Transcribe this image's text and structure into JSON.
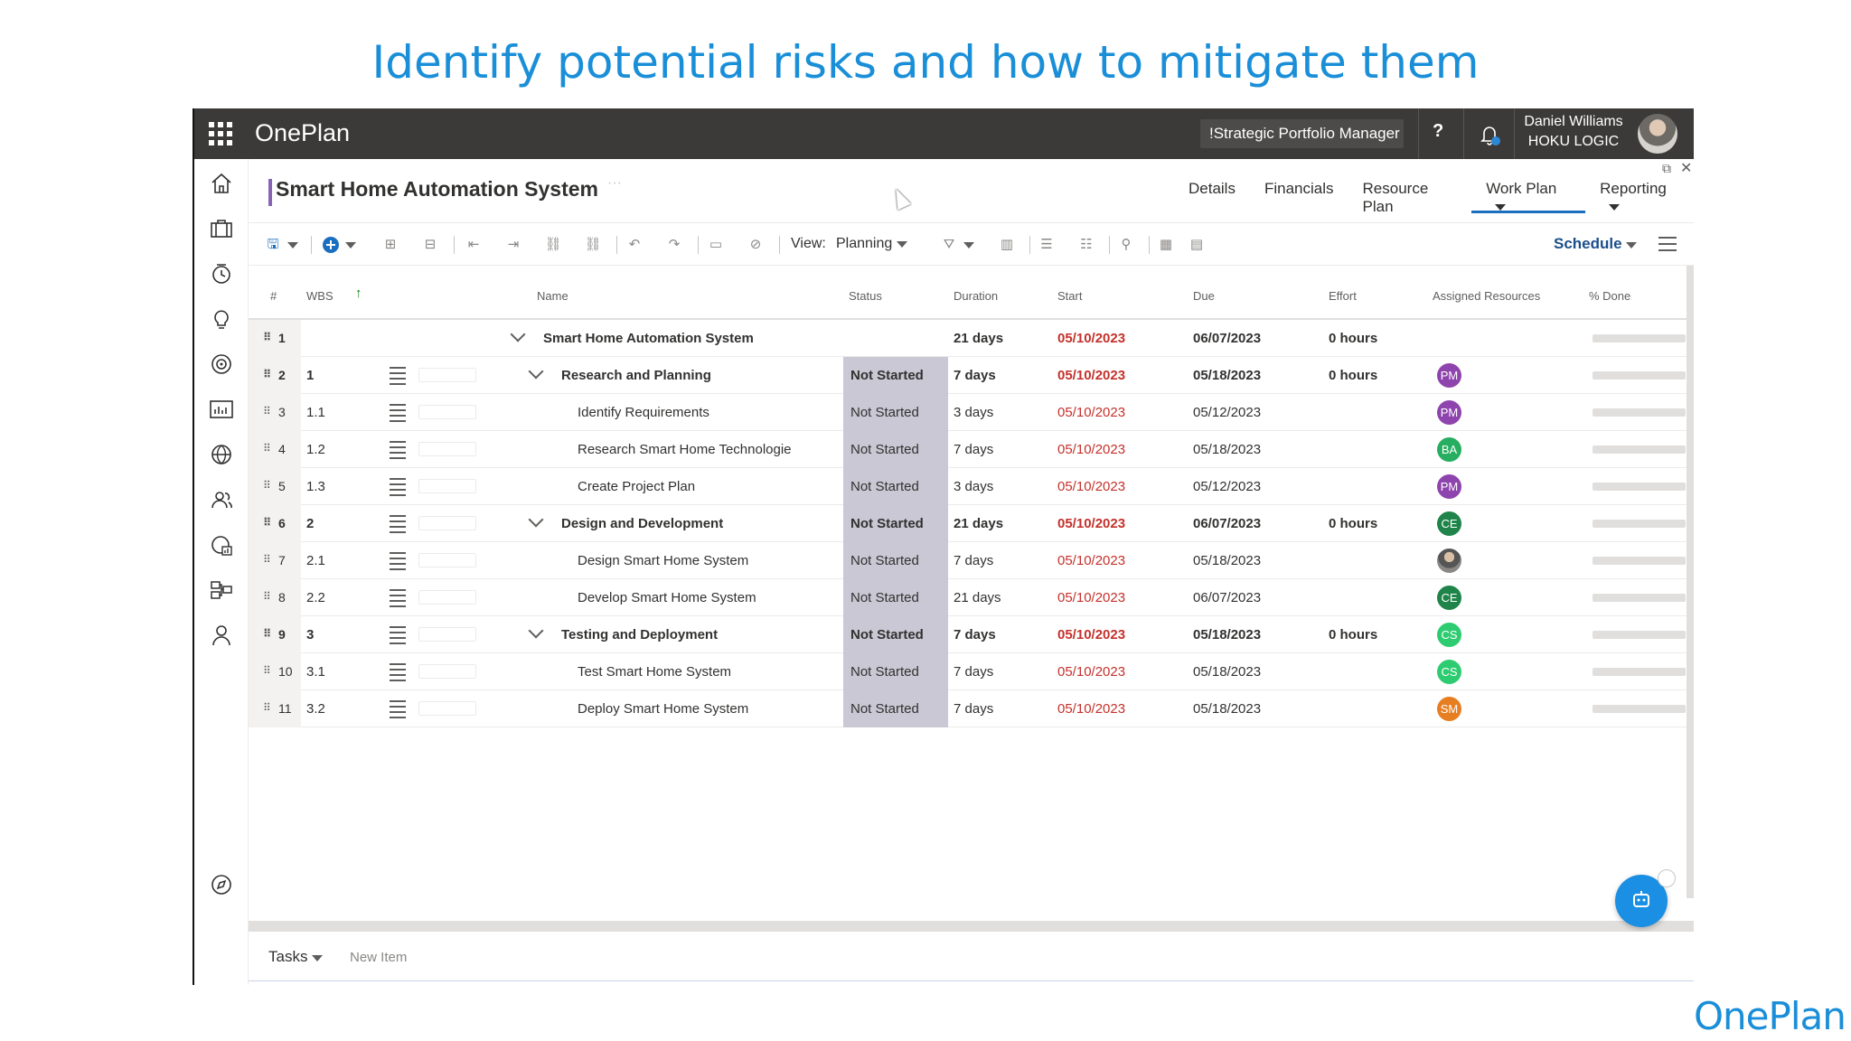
{
  "slide": {
    "title": "Identify potential risks and how to mitigate them",
    "logo": "OnePlan"
  },
  "topbar": {
    "brand": "OnePlan",
    "portfolio": "!Strategic Portfolio Manager",
    "help": "?",
    "user_name": "Daniel Williams",
    "user_org": "HOKU LOGIC"
  },
  "leftnav": [
    "home-icon",
    "portfolio-icon",
    "timesheet-icon",
    "idea-icon",
    "goals-icon",
    "reports-icon",
    "globe-icon",
    "people-icon",
    "analytics-icon",
    "org-icon",
    "profile-icon",
    "compass-icon"
  ],
  "project": {
    "title": "Smart Home Automation System",
    "more": "···",
    "tabs": [
      {
        "label": "Details",
        "caret": false
      },
      {
        "label": "Financials",
        "caret": false
      },
      {
        "label": "Resource Plan",
        "caret": false
      },
      {
        "label": "Work Plan",
        "caret": true,
        "active": true
      },
      {
        "label": "Reporting",
        "caret": true
      }
    ]
  },
  "toolbar": {
    "view_label": "View:",
    "view_value": "Planning",
    "schedule_label": "Schedule"
  },
  "columns": {
    "num": "#",
    "wbs": "WBS",
    "name": "Name",
    "status": "Status",
    "duration": "Duration",
    "start": "Start",
    "due": "Due",
    "effort": "Effort",
    "resources": "Assigned Resources",
    "done": "% Done"
  },
  "rows": [
    {
      "num": "1",
      "wbs": "",
      "name": "Smart Home Automation System",
      "status": "",
      "duration": "21 days",
      "start": "05/10/2023",
      "due": "06/07/2023",
      "effort": "0 hours",
      "resource": "",
      "bold": true,
      "level": 0
    },
    {
      "num": "2",
      "wbs": "1",
      "name": "Research and Planning",
      "status": "Not Started",
      "duration": "7 days",
      "start": "05/10/2023",
      "due": "05/18/2023",
      "effort": "0 hours",
      "resource": "PM",
      "bold": true,
      "level": 1
    },
    {
      "num": "3",
      "wbs": "1.1",
      "name": "Identify Requirements",
      "status": "Not Started",
      "duration": "3 days",
      "start": "05/10/2023",
      "due": "05/12/2023",
      "effort": "",
      "resource": "PM",
      "bold": false,
      "level": 2
    },
    {
      "num": "4",
      "wbs": "1.2",
      "name": "Research Smart Home Technologie",
      "status": "Not Started",
      "duration": "7 days",
      "start": "05/10/2023",
      "due": "05/18/2023",
      "effort": "",
      "resource": "BA",
      "bold": false,
      "level": 2
    },
    {
      "num": "5",
      "wbs": "1.3",
      "name": "Create Project Plan",
      "status": "Not Started",
      "duration": "3 days",
      "start": "05/10/2023",
      "due": "05/12/2023",
      "effort": "",
      "resource": "PM",
      "bold": false,
      "level": 2
    },
    {
      "num": "6",
      "wbs": "2",
      "name": "Design and Development",
      "status": "Not Started",
      "duration": "21 days",
      "start": "05/10/2023",
      "due": "06/07/2023",
      "effort": "0 hours",
      "resource": "CE",
      "bold": true,
      "level": 1
    },
    {
      "num": "7",
      "wbs": "2.1",
      "name": "Design Smart Home System",
      "status": "Not Started",
      "duration": "7 days",
      "start": "05/10/2023",
      "due": "05/18/2023",
      "effort": "",
      "resource": "photo",
      "bold": false,
      "level": 2
    },
    {
      "num": "8",
      "wbs": "2.2",
      "name": "Develop Smart Home System",
      "status": "Not Started",
      "duration": "21 days",
      "start": "05/10/2023",
      "due": "06/07/2023",
      "effort": "",
      "resource": "CE",
      "bold": false,
      "level": 2
    },
    {
      "num": "9",
      "wbs": "3",
      "name": "Testing and Deployment",
      "status": "Not Started",
      "duration": "7 days",
      "start": "05/10/2023",
      "due": "05/18/2023",
      "effort": "0 hours",
      "resource": "CS",
      "bold": true,
      "level": 1
    },
    {
      "num": "10",
      "wbs": "3.1",
      "name": "Test Smart Home System",
      "status": "Not Started",
      "duration": "7 days",
      "start": "05/10/2023",
      "due": "05/18/2023",
      "effort": "",
      "resource": "CS",
      "bold": false,
      "level": 2
    },
    {
      "num": "11",
      "wbs": "3.2",
      "name": "Deploy Smart Home System",
      "status": "Not Started",
      "duration": "7 days",
      "start": "05/10/2023",
      "due": "05/18/2023",
      "effort": "",
      "resource": "SM",
      "bold": false,
      "level": 2
    }
  ],
  "resource_colors": {
    "PM": "#8e44ad",
    "BA": "#27ae60",
    "CE": "#1e8449",
    "CS": "#2ecc71",
    "SM": "#e67e22"
  },
  "bottom": {
    "tasks_label": "Tasks",
    "new_item": "New Item"
  }
}
